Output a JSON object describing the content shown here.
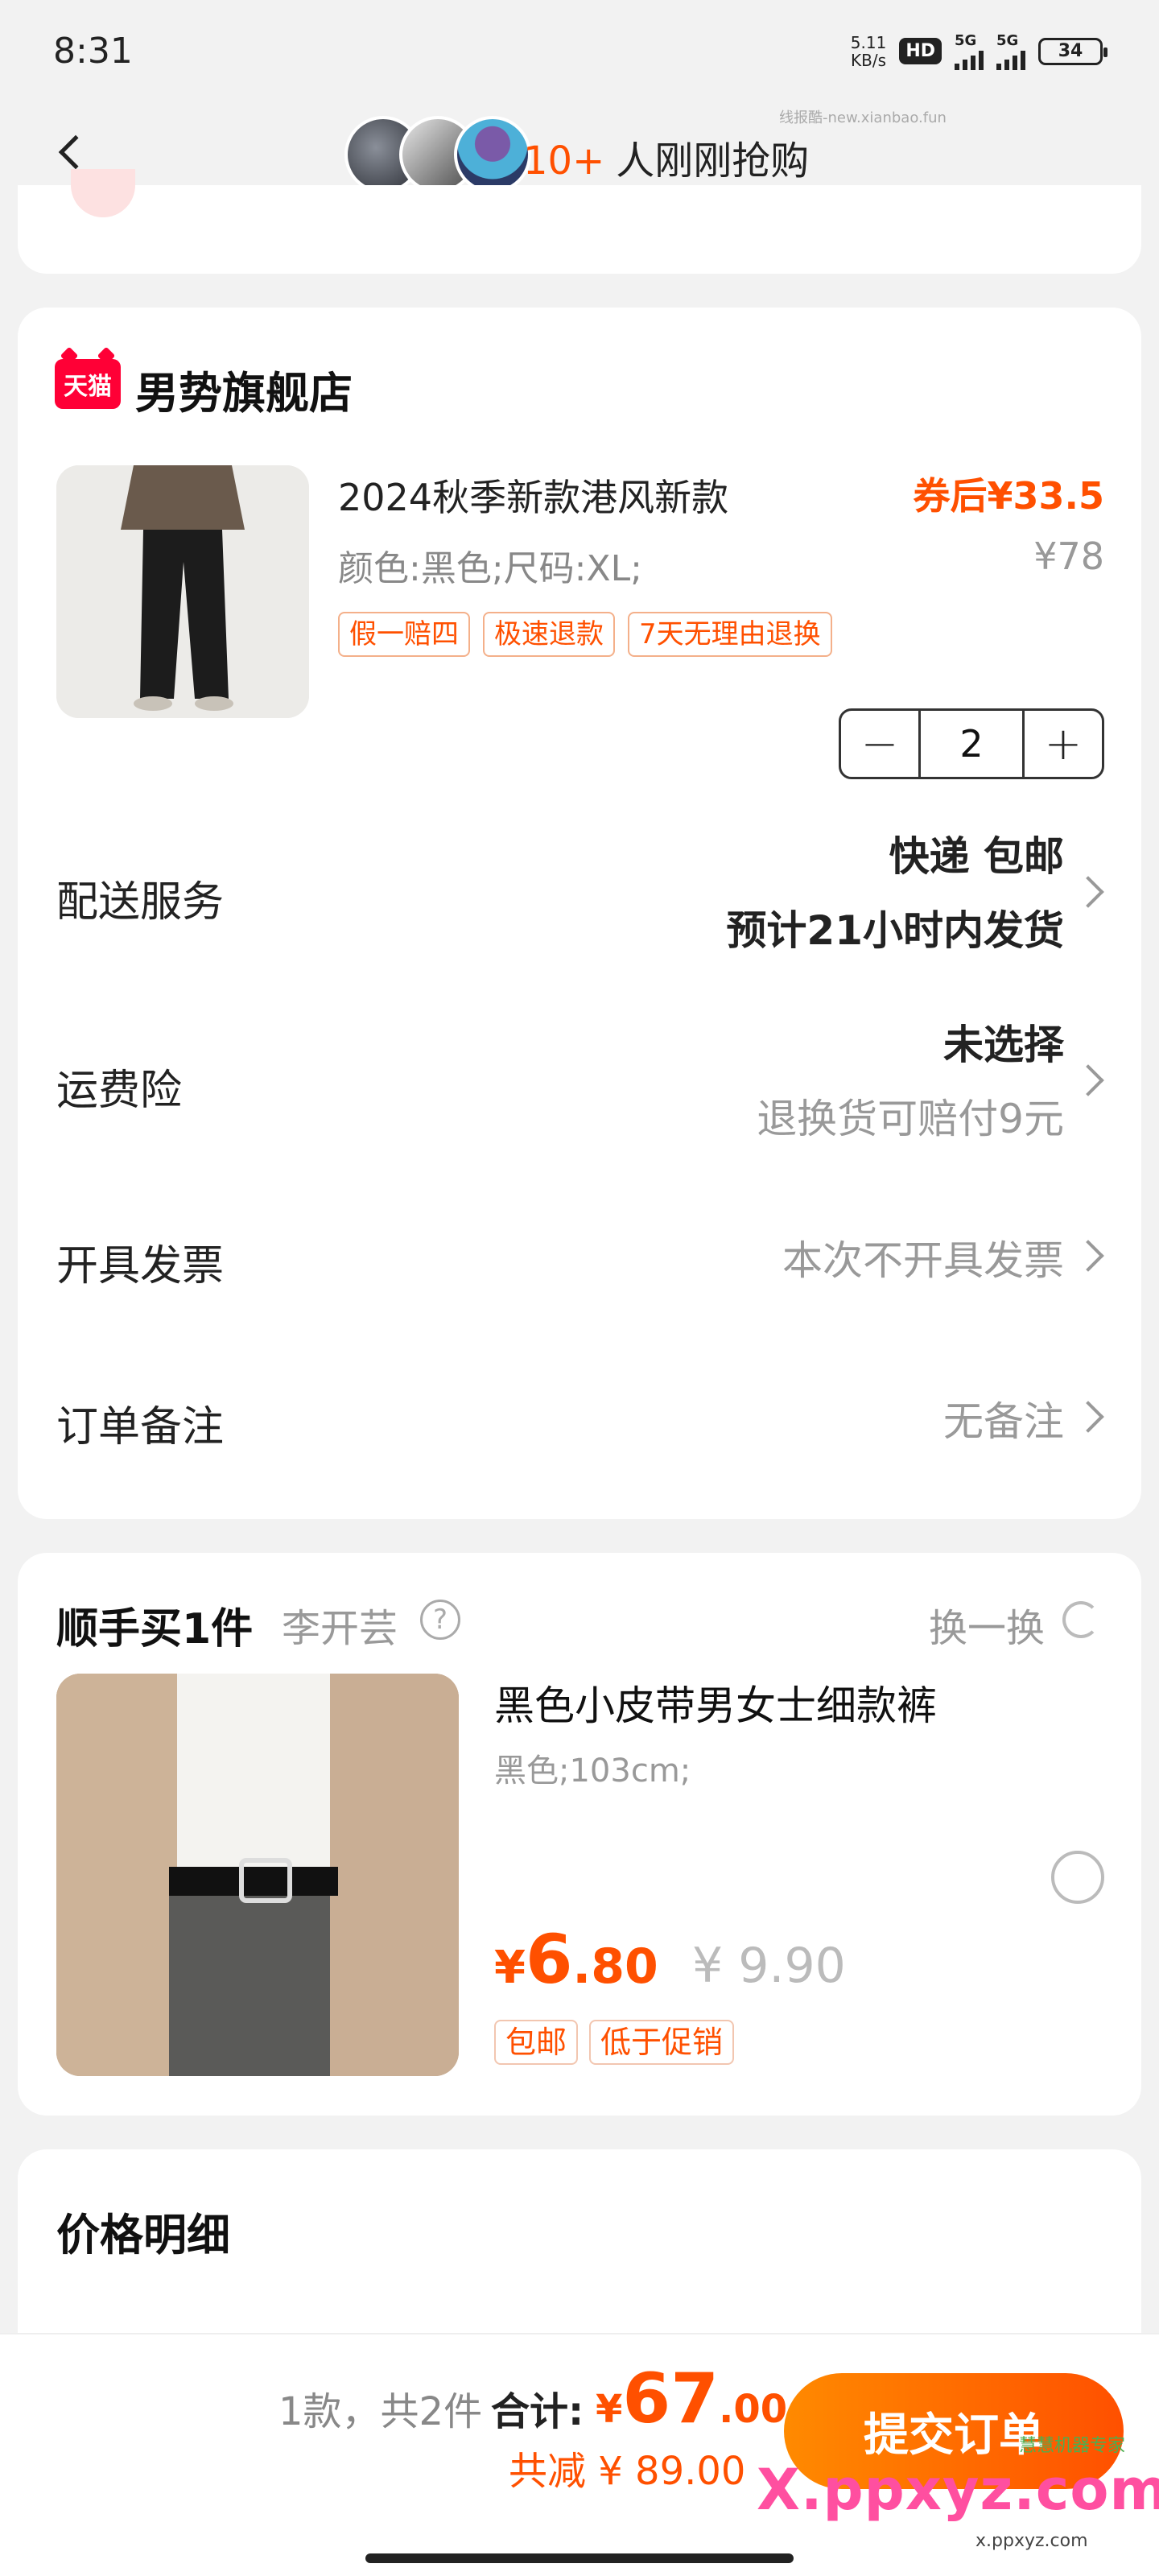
{
  "status_bar": {
    "time": "8:31",
    "net_speed": "5.11\nKB/s",
    "hd": "HD",
    "sim1": "5G",
    "sim2": "5G",
    "battery": "34"
  },
  "nav": {
    "buyers_count": "10+",
    "buyers_text": "人刚刚抢购",
    "watermark": "线报酷-new.xianbao.fun"
  },
  "shop": {
    "badge": "天猫",
    "name": "男势旗舰店",
    "product": {
      "title": "2024秋季新款港风新款",
      "spec": "颜色:黑色;尺码:XL;",
      "price_after": "券后¥33.5",
      "price_orig": "¥78",
      "tags": [
        "假一赔四",
        "极速退款",
        "7天无理由退换"
      ],
      "qty": "2",
      "minus": "−",
      "plus": "+"
    },
    "delivery": {
      "label": "配送服务",
      "line1": "快递 包邮",
      "line2": "预计21小时内发货"
    },
    "insurance": {
      "label": "运费险",
      "line1": "未选择",
      "line2": "退换货可赔付9元"
    },
    "invoice": {
      "label": "开具发票",
      "value": "本次不开具发票"
    },
    "note": {
      "label": "订单备注",
      "value": "无备注"
    }
  },
  "addon": {
    "title": "顺手买1件",
    "author": "李开芸",
    "help": "?",
    "swap": "换一换",
    "name": "黑色小皮带男女士细款裤",
    "spec": "黑色;103cm;",
    "price_cur": "¥",
    "price_int": "6",
    "price_dec": ".80",
    "price_orig": "¥ 9.90",
    "tags": [
      "包邮",
      "低于促销"
    ]
  },
  "detail": {
    "title": "价格明细"
  },
  "bottom": {
    "count": "1款，共2件",
    "total_label": "合计:",
    "total_cur": "¥",
    "total_int": "67",
    "total_dec": ".00",
    "saved": "共减 ¥ 89.00",
    "submit": "提交订单",
    "wm_main": "X.ppxyz.com",
    "wm_sub": "x.ppxyz.com",
    "wm_small": "慧慧机器专家"
  }
}
